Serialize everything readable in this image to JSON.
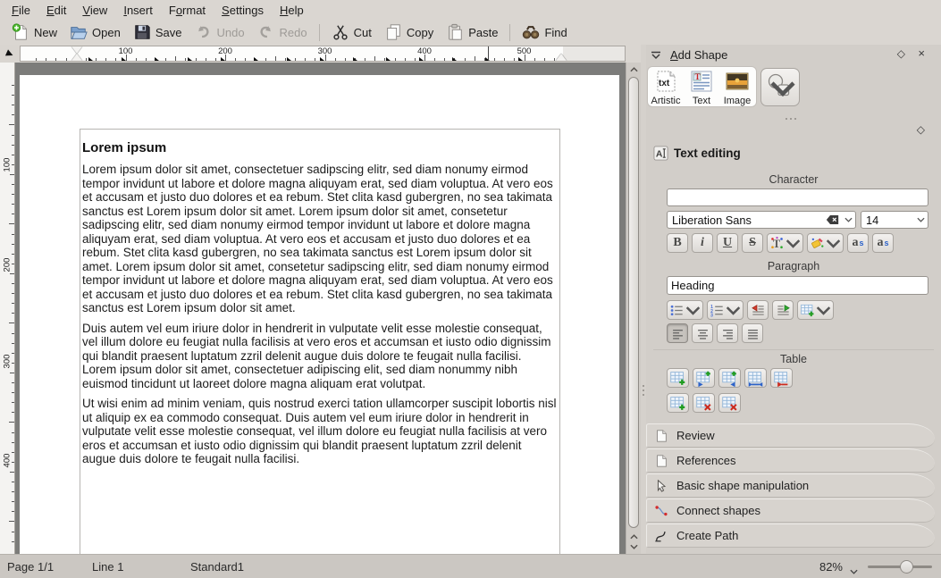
{
  "menu": {
    "items": [
      {
        "label": "File",
        "u": 0
      },
      {
        "label": "Edit",
        "u": 0
      },
      {
        "label": "View",
        "u": 0
      },
      {
        "label": "Insert",
        "u": 0
      },
      {
        "label": "Format",
        "u": 1
      },
      {
        "label": "Settings",
        "u": 0
      },
      {
        "label": "Help",
        "u": 0
      }
    ]
  },
  "toolbar": {
    "buttons": [
      {
        "label": "New",
        "icon": "new-file-icon"
      },
      {
        "label": "Open",
        "icon": "open-folder-icon"
      },
      {
        "label": "Save",
        "icon": "save-floppy-icon"
      },
      {
        "label": "Undo",
        "icon": "undo-arrow-icon",
        "disabled": true
      },
      {
        "label": "Redo",
        "icon": "redo-arrow-icon",
        "disabled": true
      },
      {
        "sep": true
      },
      {
        "label": "Cut",
        "icon": "cut-scissors-icon"
      },
      {
        "label": "Copy",
        "icon": "copy-pages-icon"
      },
      {
        "label": "Paste",
        "icon": "paste-clipboard-icon"
      },
      {
        "sep": true
      },
      {
        "label": "Find",
        "icon": "find-binoculars-icon"
      }
    ]
  },
  "rulers": {
    "horizontal_numbers": [
      "100",
      "200",
      "300",
      "400",
      "500"
    ],
    "vertical_numbers": [
      "100",
      "200",
      "300",
      "400"
    ]
  },
  "document": {
    "title": "Lorem ipsum",
    "paragraphs": [
      "Lorem ipsum dolor sit amet, consectetuer sadipscing elitr, sed diam nonumy eirmod tempor invidunt ut labore et dolore magna aliquyam erat, sed diam voluptua. At vero eos et accusam et justo duo dolores et ea rebum. Stet clita kasd gubergren, no sea takimata sanctus est Lorem ipsum dolor sit amet. Lorem ipsum dolor sit amet, consetetur sadipscing elitr, sed diam nonumy eirmod tempor invidunt ut labore et dolore magna aliquyam erat, sed diam voluptua. At vero eos et accusam et justo duo dolores et ea rebum. Stet clita kasd gubergren, no sea takimata sanctus est Lorem ipsum dolor sit amet. Lorem ipsum dolor sit amet, consetetur sadipscing elitr, sed diam nonumy eirmod tempor invidunt ut labore et dolore magna aliquyam erat, sed diam voluptua. At vero eos et accusam et justo duo dolores et ea rebum. Stet clita kasd gubergren, no sea takimata sanctus est Lorem ipsum dolor sit amet.",
      "Duis autem vel eum iriure dolor in hendrerit in vulputate velit esse molestie consequat, vel illum dolore eu feugiat nulla facilisis at vero eros et accumsan et iusto odio dignissim qui blandit praesent luptatum zzril delenit augue duis dolore te feugait nulla facilisi. Lorem ipsum dolor sit amet, consectetuer adipiscing elit, sed diam nonummy nibh euismod tincidunt ut laoreet dolore magna aliquam erat volutpat.",
      "Ut wisi enim ad minim veniam, quis nostrud exerci tation ullamcorper suscipit lobortis nisl ut aliquip ex ea commodo consequat. Duis autem vel eum iriure dolor in hendrerit in vulputate velit esse molestie consequat, vel illum dolore eu feugiat nulla facilisis at vero eros et accumsan et iusto odio dignissim qui blandit praesent luptatum zzril delenit augue duis dolore te feugait nulla facilisi."
    ]
  },
  "panels": {
    "add_shape": {
      "title": "Add Shape",
      "u": 0,
      "shapes": [
        {
          "label": "Artistic",
          "icon": "artistic-text-icon"
        },
        {
          "label": "Text",
          "icon": "text-frame-icon"
        },
        {
          "label": "Image",
          "icon": "image-shape-icon"
        }
      ]
    },
    "text_editing": {
      "title": "Text editing",
      "character_label": "Character",
      "character_value": "",
      "font_name": "Liberation Sans",
      "font_size": "14",
      "format_buttons": [
        {
          "name": "bold",
          "glyph": "B"
        },
        {
          "name": "italic",
          "glyph": "i"
        },
        {
          "name": "underline",
          "glyph": "U"
        },
        {
          "name": "strikethrough",
          "glyph": "S"
        },
        {
          "name": "font-color",
          "icon": "font-color-icon",
          "chevron": true
        },
        {
          "name": "highlight-color",
          "icon": "highlight-icon",
          "chevron": true
        },
        {
          "name": "superscript",
          "glyph": "a",
          "sup": "s"
        },
        {
          "name": "subscript",
          "glyph": "a",
          "sub": "s"
        }
      ],
      "paragraph_label": "Paragraph",
      "style_value": "Heading",
      "paragraph_buttons": [
        {
          "name": "bullet-list",
          "icon": "bullet-list-icon",
          "chevron": true
        },
        {
          "name": "numbered-list",
          "icon": "numbered-list-icon",
          "chevron": true
        },
        {
          "name": "decrease-indent",
          "icon": "decrease-indent-icon"
        },
        {
          "name": "increase-indent",
          "icon": "increase-indent-icon"
        },
        {
          "name": "insert-variable",
          "icon": "grid-plus-icon",
          "chevron": true
        }
      ],
      "align_buttons": [
        {
          "name": "align-left",
          "icon": "align-left-icon",
          "pressed": true
        },
        {
          "name": "align-center",
          "icon": "align-center-icon"
        },
        {
          "name": "align-right",
          "icon": "align-right-icon"
        },
        {
          "name": "align-justify",
          "icon": "align-justify-icon"
        }
      ],
      "table_label": "Table",
      "table_buttons_row1": [
        {
          "name": "insert-rows",
          "overlay": "plus",
          "color": "#1f9c1f"
        },
        {
          "name": "insert-columns-left",
          "overlay": "plus-left",
          "color": "#1f9c1f"
        },
        {
          "name": "insert-columns-right",
          "overlay": "plus-right",
          "color": "#1f9c1f"
        },
        {
          "name": "adjust-column-width",
          "overlay": "harrows",
          "color": "#2b62c9"
        },
        {
          "name": "split-cells",
          "overlay": "larrow",
          "color": "#cc2a1e"
        }
      ],
      "table_buttons_row2": [
        {
          "name": "insert-cells",
          "overlay": "plus",
          "color": "#1f9c1f"
        },
        {
          "name": "delete-rows",
          "overlay": "cross",
          "color": "#cc2a1e"
        },
        {
          "name": "delete-columns",
          "overlay": "cross",
          "color": "#cc2a1e"
        }
      ]
    },
    "collapsed": [
      {
        "label": "Review",
        "icon": "document-page-icon"
      },
      {
        "label": "References",
        "icon": "document-page-icon"
      },
      {
        "label": "Basic shape manipulation",
        "icon": "cursor-arrow-icon"
      },
      {
        "label": "Connect shapes",
        "icon": "connect-line-icon"
      },
      {
        "label": "Create Path",
        "icon": "path-curve-icon"
      }
    ]
  },
  "statusbar": {
    "page": "Page 1/1",
    "line": "Line 1",
    "style": "Standard1",
    "zoom": "82%"
  },
  "colors": {
    "window_bg": "#dad6d1",
    "panel_bg": "#d2cec9",
    "canvas_surround": "#7c7c7a",
    "page_bg": "#ffffff",
    "statusbar_bg": "#cbc7c2"
  }
}
